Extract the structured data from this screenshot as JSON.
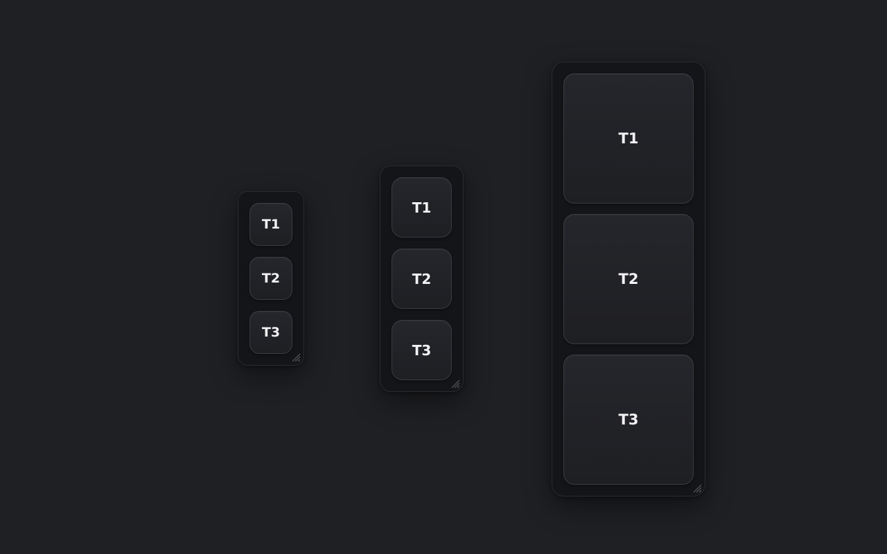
{
  "panels": [
    {
      "id": "small",
      "tiles": [
        {
          "label": "T1"
        },
        {
          "label": "T2"
        },
        {
          "label": "T3"
        }
      ]
    },
    {
      "id": "medium",
      "tiles": [
        {
          "label": "T1"
        },
        {
          "label": "T2"
        },
        {
          "label": "T3"
        }
      ]
    },
    {
      "id": "large",
      "tiles": [
        {
          "label": "T1"
        },
        {
          "label": "T2"
        },
        {
          "label": "T3"
        }
      ]
    }
  ],
  "icons": {
    "resize": "resize-grip-icon"
  },
  "colors": {
    "background": "#1f2024",
    "panel": "#141518",
    "tile": "#232428",
    "tile_border": "#3a3c42",
    "label": "#f2f2f4"
  }
}
